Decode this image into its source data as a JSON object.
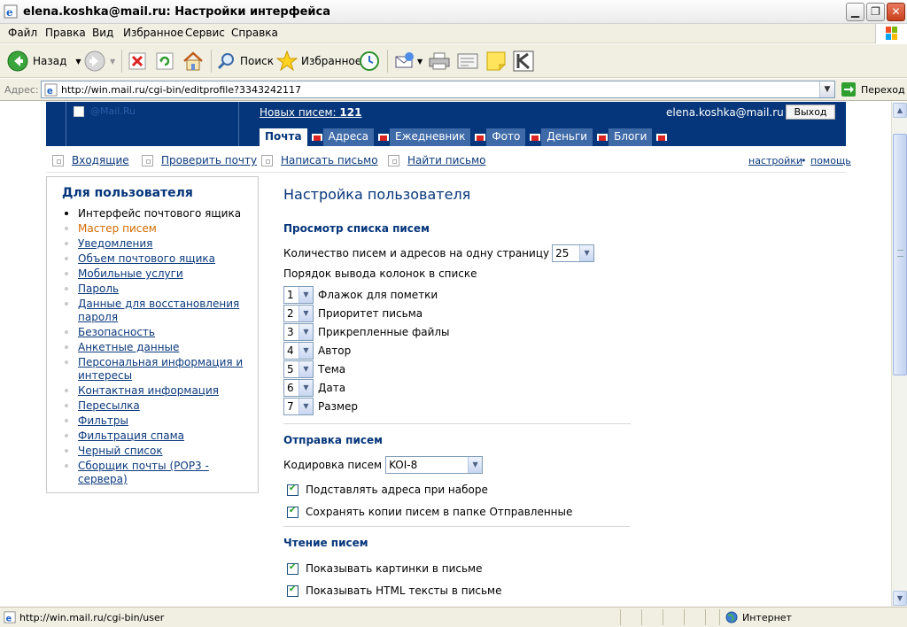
{
  "window": {
    "title": "elena.koshka@mail.ru: Настройки интерфейса"
  },
  "menu": [
    "Файл",
    "Правка",
    "Вид",
    "Избранное",
    "Сервис",
    "Справка"
  ],
  "toolbar": {
    "back": "Назад",
    "search": "Поиск",
    "favorites": "Избранное"
  },
  "address": {
    "label": "Адрес:",
    "url": "http://win.mail.ru/cgi-bin/editprofile?3343242117",
    "go": "Переход"
  },
  "header": {
    "logo": "@Mail.Ru",
    "new_mail_label": "Новых писем:",
    "new_mail_count": "121",
    "user": "elena.koshka@mail.ru",
    "logout": "Выход",
    "tabs": [
      "Почта",
      "Адреса",
      "Ежедневник",
      "Фото",
      "Деньги",
      "Блоги"
    ]
  },
  "subnav": {
    "links": [
      "Входящие",
      "Проверить почту",
      "Написать письмо",
      "Найти письмо"
    ],
    "settings": "настройки",
    "dot": "•",
    "help": "помощь"
  },
  "sidebar": {
    "title": "Для пользователя",
    "items": [
      "Интерфейс почтового ящика",
      "Мастер писем",
      "Уведомления",
      "Объем почтового ящика",
      "Мобильные услуги",
      "Пароль",
      "Данные для восстановления пароля",
      "Безопасность",
      "Анкетные данные",
      "Персональная информация и интересы",
      "Контактная информация",
      "Пересылка",
      "Фильтры",
      "Фильтрация спама",
      "Черный список",
      "Сборщик почты (POP3 - сервера)"
    ]
  },
  "main": {
    "title": "Настройка пользователя",
    "view_section": "Просмотр списка писем",
    "per_page_label": "Количество писем и адресов на одну страницу",
    "per_page_value": "25",
    "order_label": "Порядок вывода колонок в списке",
    "columns": [
      {
        "num": "1",
        "label": "Флажок для пометки"
      },
      {
        "num": "2",
        "label": "Приоритет письма"
      },
      {
        "num": "3",
        "label": "Прикрепленные файлы"
      },
      {
        "num": "4",
        "label": "Автор"
      },
      {
        "num": "5",
        "label": "Тема"
      },
      {
        "num": "6",
        "label": "Дата"
      },
      {
        "num": "7",
        "label": "Размер"
      }
    ],
    "send_section": "Отправка писем",
    "encoding_label": "Кодировка писем",
    "encoding_value": "KOI-8",
    "send_options": [
      {
        "label": "Подставлять адреса при наборе",
        "checked": true
      },
      {
        "label": "Сохранять копии писем в папке Отправленные",
        "checked": true
      }
    ],
    "read_section": "Чтение писем",
    "read_options": [
      {
        "label": "Показывать картинки в письме",
        "checked": true
      },
      {
        "label": "Показывать HTML тексты в письме",
        "checked": true
      }
    ]
  },
  "status": {
    "url": "http://win.mail.ru/cgi-bin/user",
    "zone": "Интернет"
  }
}
